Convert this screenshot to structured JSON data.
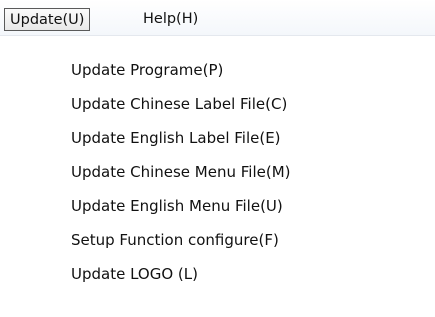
{
  "menubar": {
    "items": [
      {
        "label": "Update(U)"
      },
      {
        "label": "Help(H)"
      }
    ]
  },
  "update_menu": {
    "items": [
      {
        "label": "Update Programe(P)"
      },
      {
        "label": "Update Chinese Label File(C)"
      },
      {
        "label": "Update English Label File(E)"
      },
      {
        "label": "Update Chinese Menu File(M)"
      },
      {
        "label": "Update English Menu File(U)"
      },
      {
        "label": "Setup Function configure(F)"
      },
      {
        "label": "Update LOGO (L)"
      }
    ]
  }
}
